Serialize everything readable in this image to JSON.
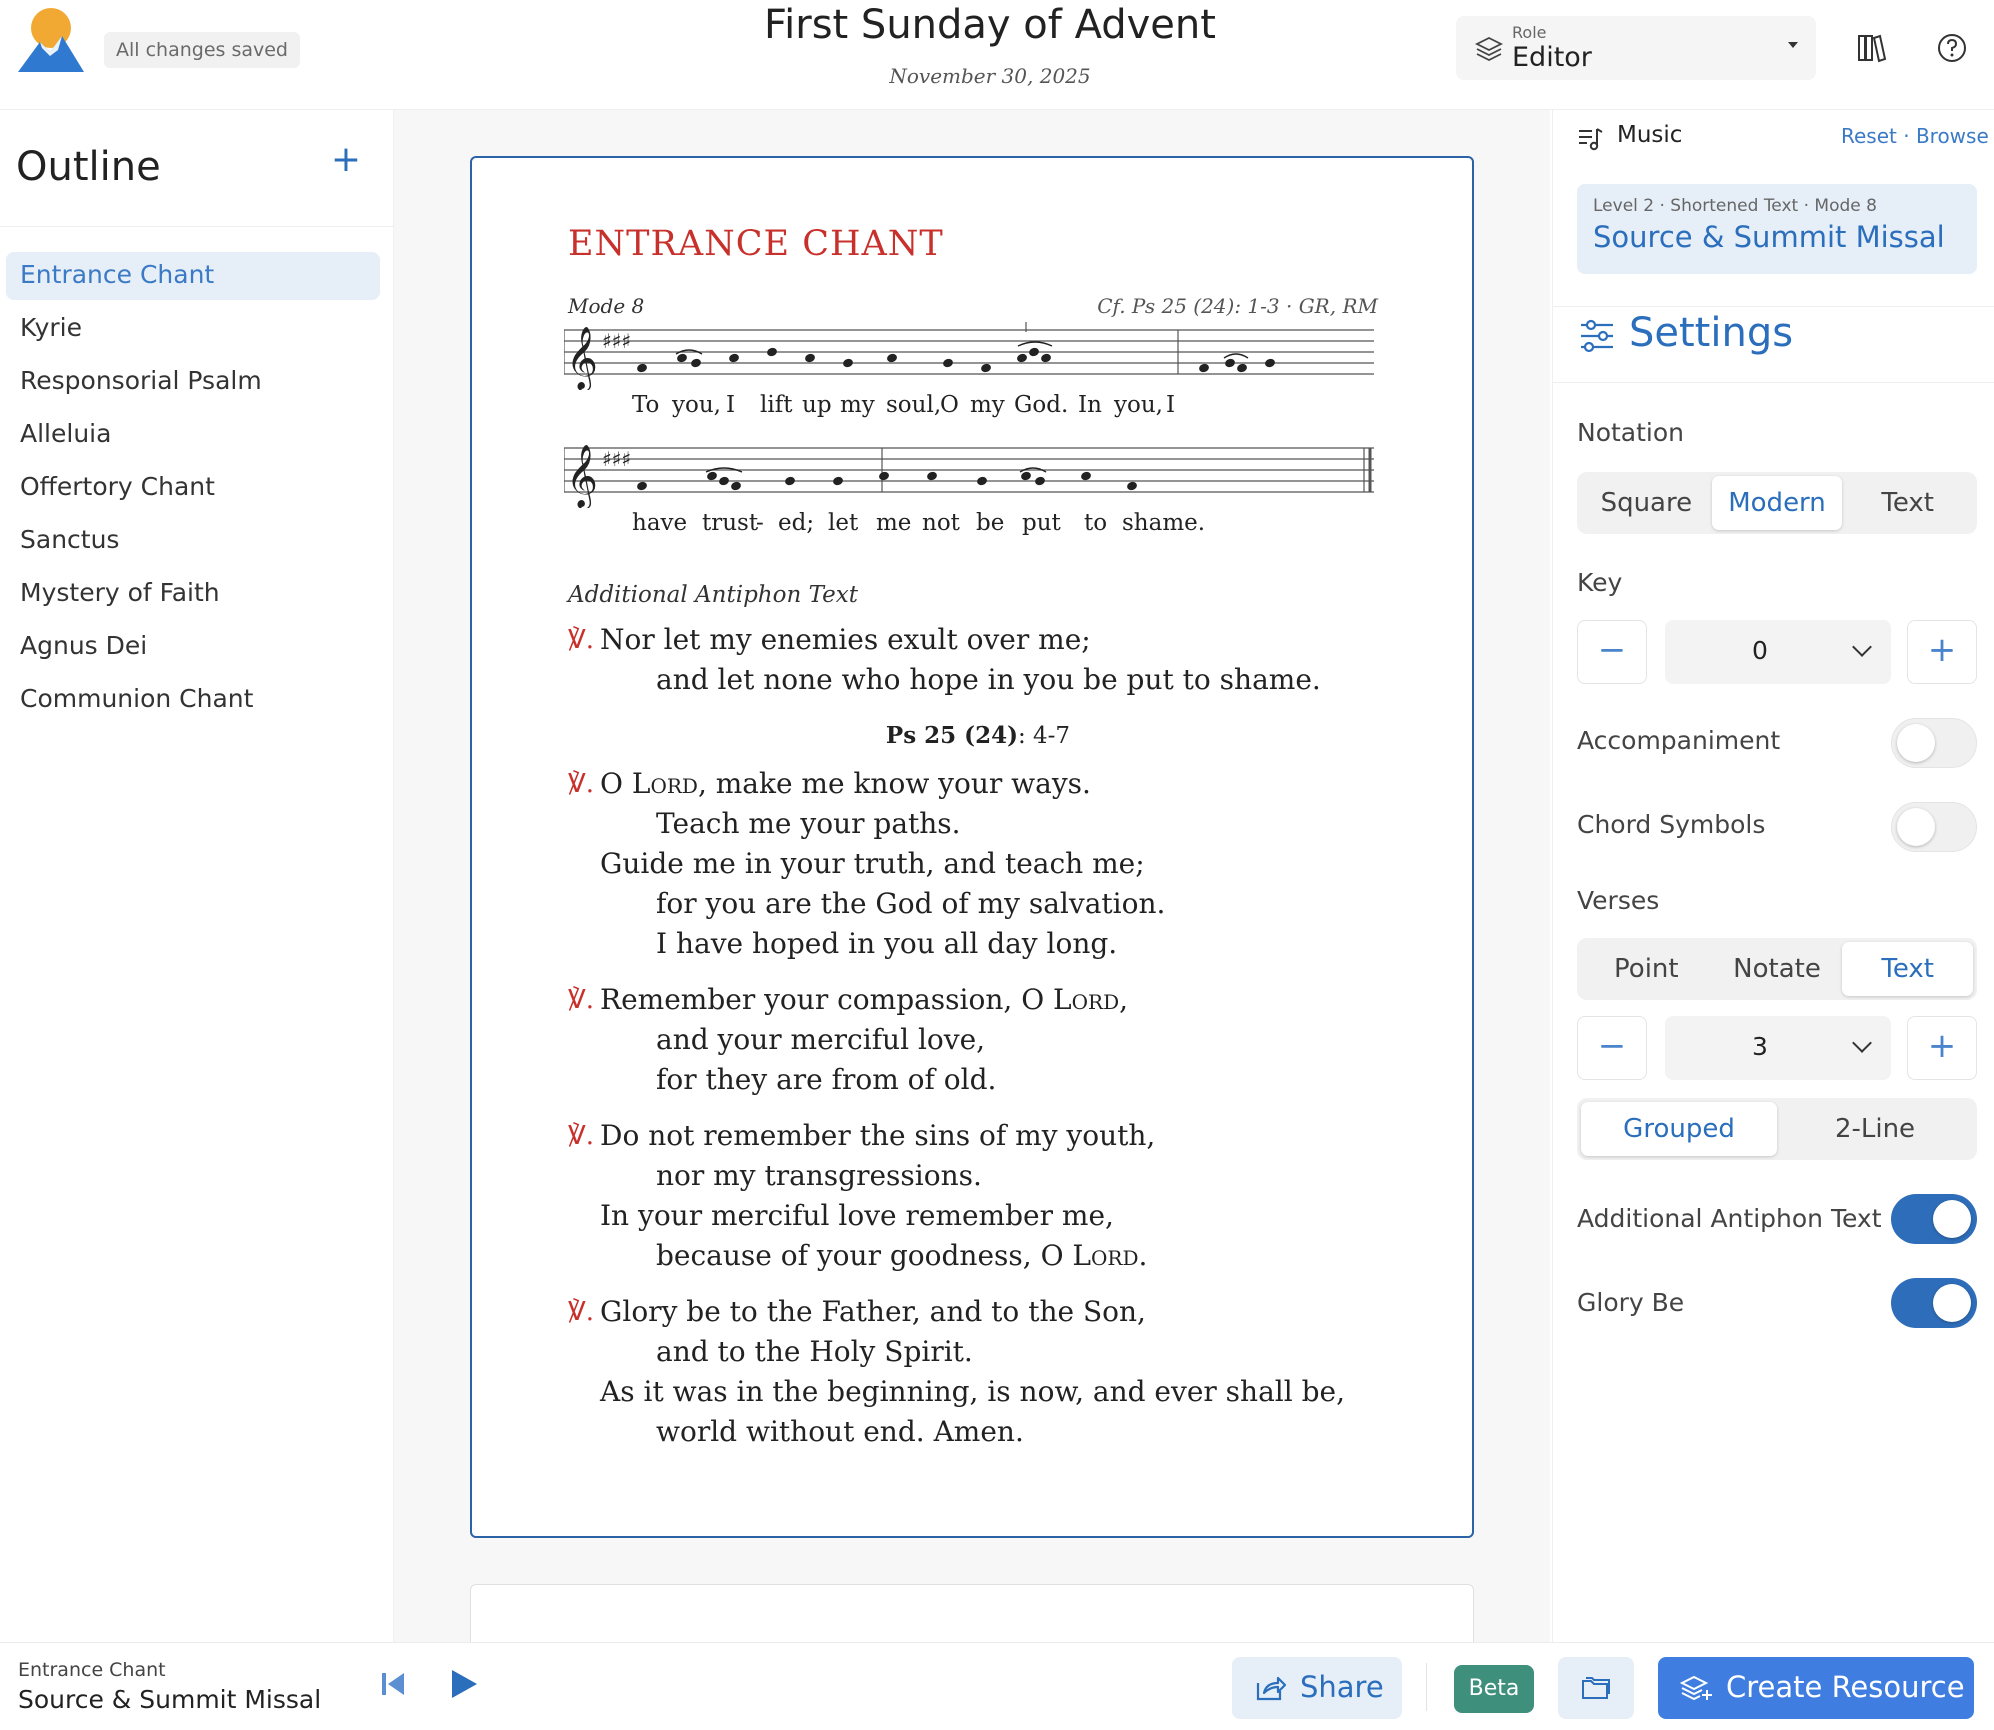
{
  "header": {
    "save_status": "All changes saved",
    "title": "First Sunday of Advent",
    "date": "November 30, 2025",
    "role_label": "Role",
    "role_value": "Editor"
  },
  "outline": {
    "title": "Outline",
    "add_symbol": "+",
    "items": [
      {
        "label": "Entrance Chant",
        "active": true
      },
      {
        "label": "Kyrie"
      },
      {
        "label": "Responsorial Psalm"
      },
      {
        "label": "Alleluia"
      },
      {
        "label": "Offertory Chant"
      },
      {
        "label": "Sanctus"
      },
      {
        "label": "Mystery of Faith"
      },
      {
        "label": "Agnus Dei"
      },
      {
        "label": "Communion Chant"
      }
    ]
  },
  "document": {
    "chant_title": "ENTRANCE CHANT",
    "mode": "Mode 8",
    "source_ref": "Cf. Ps 25 (24): 1-3 · GR, RM",
    "staff1_lyrics": [
      "To",
      "you,",
      "I",
      "lift",
      "up",
      "my",
      "soul,",
      "O",
      "my",
      "God.",
      "In",
      "you,",
      "I"
    ],
    "staff2_lyrics": [
      "have",
      "trust",
      "-",
      "ed;",
      "let",
      "me",
      "not",
      "be",
      "put",
      "to",
      "shame."
    ],
    "additional_antiphon_label": "Additional Antiphon Text",
    "verse_mark": "℣.",
    "antiphon_line1": "Nor let my enemies exult over me;",
    "antiphon_line2": "and let none who hope in you be put to shame.",
    "psalm_ref_bold": "Ps 25 (24)",
    "psalm_ref_rest": ": 4-7",
    "lord": "Lord",
    "v1_l1_pre": "O ",
    "v1_l1_post": ", make me know your ways.",
    "v1_l2": "Teach me your paths.",
    "v1_l3": "Guide me in your truth, and teach me;",
    "v1_l4": "for you are the God of my salvation.",
    "v1_l5": "I have hoped in you all day long.",
    "v2_l1_pre": "Remember your compassion, O ",
    "v2_l1_post": ",",
    "v2_l2": "and your merciful love,",
    "v2_l3": "for they are from of old.",
    "v3_l1": "Do not remember the sins of my youth,",
    "v3_l2": "nor my transgressions.",
    "v3_l3": "In your merciful love remember me,",
    "v3_l4_pre": "because of your goodness, O ",
    "v3_l4_post": ".",
    "v4_l1": "Glory be to the Father, and to the Son,",
    "v4_l2": "and to the Holy Spirit.",
    "v4_l3": "As it was in the beginning, is now, and ever shall be,",
    "v4_l4": "world without end. Amen."
  },
  "music": {
    "label": "Music",
    "links": "Reset · Browse",
    "meta": "Level 2 · Shortened Text · Mode 8",
    "source": "Source & Summit Missal"
  },
  "settings": {
    "title": "Settings",
    "notation_label": "Notation",
    "notation_options": [
      "Square",
      "Modern",
      "Text"
    ],
    "notation_selected": "Modern",
    "key_label": "Key",
    "key_value": "0",
    "minus": "−",
    "plus": "+",
    "accompaniment_label": "Accompaniment",
    "accompaniment_on": false,
    "chords_label": "Chord Symbols",
    "chords_on": false,
    "verses_label": "Verses",
    "verses_options": [
      "Point",
      "Notate",
      "Text"
    ],
    "verses_selected": "Text",
    "verses_count": "3",
    "layout_options": [
      "Grouped",
      "2-Line"
    ],
    "layout_selected": "Grouped",
    "additional_label": "Additional Antiphon Text",
    "additional_on": true,
    "glory_label": "Glory Be",
    "glory_on": true
  },
  "footer": {
    "now_label": "Entrance Chant",
    "now_source": "Source & Summit Missal",
    "share": "Share",
    "beta": "Beta",
    "create": "Create Resource"
  },
  "colors": {
    "accent": "#2a6ebc",
    "rubric_red": "#c8302c",
    "beta_green": "#3e8f7c",
    "create_blue": "#3f7ee0"
  }
}
